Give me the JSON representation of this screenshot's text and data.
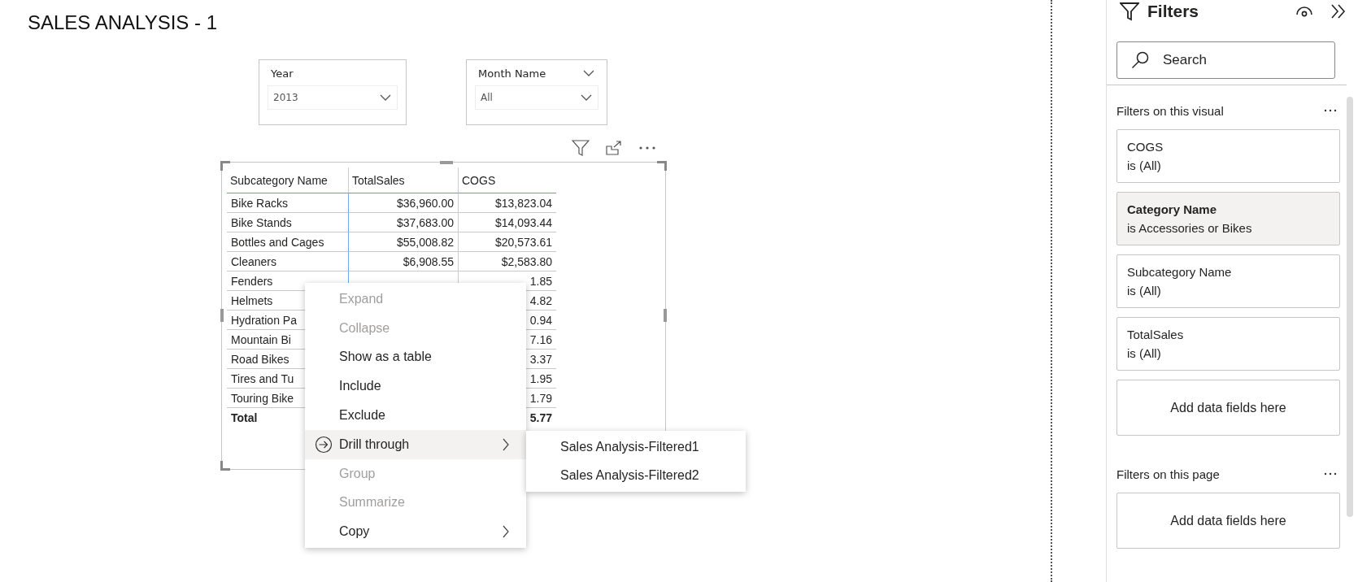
{
  "page_title": "SALES ANALYSIS - 1",
  "slicers": [
    {
      "label": "Year",
      "value": "2013",
      "header_caret": false
    },
    {
      "label": "Month Name",
      "value": "All",
      "header_caret": true
    }
  ],
  "table": {
    "columns": [
      "Subcategory Name",
      "TotalSales",
      "COGS"
    ],
    "rows": [
      {
        "kind": "data",
        "cells": [
          "Bike Racks",
          "$36,960.00",
          "$13,823.04"
        ]
      },
      {
        "kind": "data",
        "cells": [
          "Bike Stands",
          "$37,683.00",
          "$14,093.44"
        ]
      },
      {
        "kind": "data",
        "cells": [
          "Bottles and Cages",
          "$55,008.82",
          "$20,573.61"
        ]
      },
      {
        "kind": "data",
        "cells": [
          "Cleaners",
          "$6,908.55",
          "$2,583.80"
        ]
      },
      {
        "kind": "data",
        "cells": [
          "Fenders",
          null,
          "1.85"
        ]
      },
      {
        "kind": "data",
        "cells": [
          "Helmets",
          null,
          "4.82"
        ]
      },
      {
        "kind": "data",
        "cells": [
          "Hydration Pa",
          null,
          "0.94"
        ]
      },
      {
        "kind": "data",
        "cells": [
          "Mountain Bi",
          null,
          "7.16"
        ]
      },
      {
        "kind": "data",
        "cells": [
          "Road Bikes",
          null,
          "3.37"
        ]
      },
      {
        "kind": "data",
        "cells": [
          "Tires and Tu",
          null,
          "1.95"
        ]
      },
      {
        "kind": "data",
        "cells": [
          "Touring Bike",
          null,
          "1.79"
        ]
      },
      {
        "kind": "total",
        "cells": [
          "Total",
          null,
          "5.77"
        ]
      }
    ]
  },
  "context_menu": {
    "items": [
      {
        "label": "Expand",
        "disabled": true,
        "selected": false,
        "submenu": false,
        "icon": false
      },
      {
        "label": "Collapse",
        "disabled": true,
        "selected": false,
        "submenu": false,
        "icon": false
      },
      {
        "label": "Show as a table",
        "disabled": false,
        "selected": false,
        "submenu": false,
        "icon": false
      },
      {
        "label": "Include",
        "disabled": false,
        "selected": false,
        "submenu": false,
        "icon": false
      },
      {
        "label": "Exclude",
        "disabled": false,
        "selected": false,
        "submenu": false,
        "icon": false
      },
      {
        "label": "Drill through",
        "disabled": false,
        "selected": true,
        "submenu": true,
        "icon": true
      },
      {
        "label": "Group",
        "disabled": true,
        "selected": false,
        "submenu": false,
        "icon": false
      },
      {
        "label": "Summarize",
        "disabled": true,
        "selected": false,
        "submenu": false,
        "icon": false
      },
      {
        "label": "Copy",
        "disabled": false,
        "selected": false,
        "submenu": true,
        "icon": false
      }
    ],
    "submenu": [
      "Sales Analysis-Filtered1",
      "Sales Analysis-Filtered2"
    ]
  },
  "filters_pane": {
    "title": "Filters",
    "search": {
      "placeholder": "Search"
    },
    "sections": [
      {
        "title": "Filters on this visual",
        "cards": [
          {
            "kind": "filter",
            "field": "COGS",
            "condition": "is (All)",
            "selected": false
          },
          {
            "kind": "filter",
            "field": "Category Name",
            "condition": "is Accessories or Bikes",
            "selected": true
          },
          {
            "kind": "filter",
            "field": "Subcategory Name",
            "condition": "is (All)",
            "selected": false
          },
          {
            "kind": "filter",
            "field": "TotalSales",
            "condition": "is (All)",
            "selected": false
          },
          {
            "kind": "drop",
            "text": "Add data fields here"
          }
        ]
      },
      {
        "title": "Filters on this page",
        "cards": [
          {
            "kind": "drop",
            "text": "Add data fields here"
          }
        ]
      }
    ]
  }
}
